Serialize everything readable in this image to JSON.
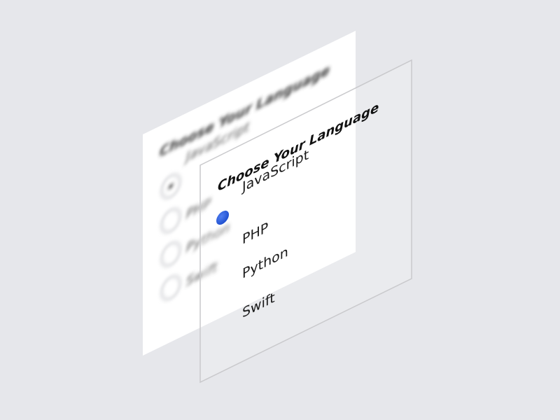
{
  "scene": {
    "back_panel": {
      "title": "Choose Your Language",
      "options": [
        "JavaScript",
        "PHP",
        "Python",
        "Swift"
      ],
      "selected_index": 0
    },
    "front_panel": {
      "title": "Choose Your Language",
      "options": [
        "JavaScript",
        "PHP",
        "Python",
        "Swift"
      ],
      "selected_index": 0
    },
    "colors": {
      "background": "#e6e7eb",
      "panel": "#ffffff",
      "accent": "#2a5bdc",
      "text": "#1a1a1a"
    }
  }
}
